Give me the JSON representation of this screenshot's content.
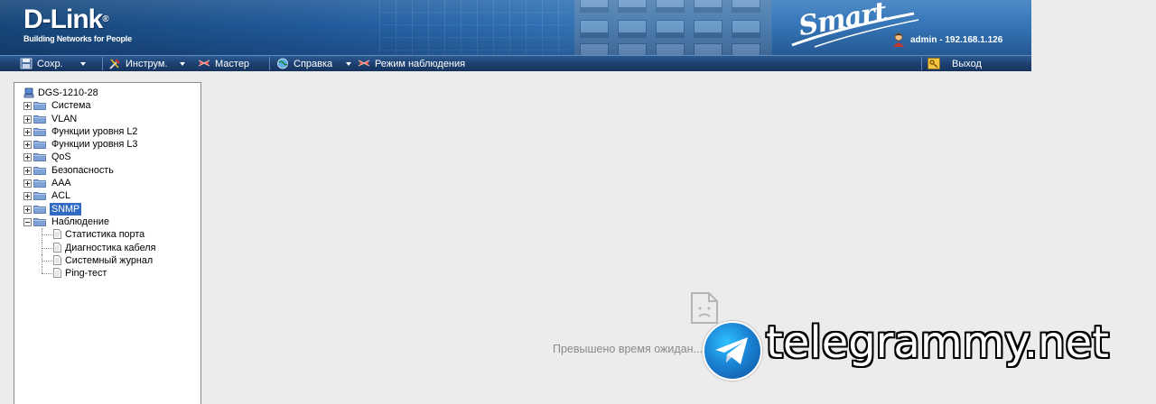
{
  "header": {
    "logo_text": "D-Link",
    "logo_reg": "®",
    "tagline": "Building Networks for People",
    "product_badge": "Smart",
    "user_info": "admin - 192.168.1.126"
  },
  "toolbar": {
    "save": "Сохр.",
    "tools": "Инструм.",
    "wizard": "Мастер",
    "help": "Справка",
    "monitor_mode": "Режим наблюдения",
    "logout": "Выход"
  },
  "tree": {
    "root": "DGS-1210-28",
    "folders": [
      {
        "label": "Система"
      },
      {
        "label": "VLAN"
      },
      {
        "label": "Функции уровня L2"
      },
      {
        "label": "Функции уровня L3"
      },
      {
        "label": "QoS"
      },
      {
        "label": "Безопасность"
      },
      {
        "label": "AAA"
      },
      {
        "label": "ACL"
      },
      {
        "label": "SNMP"
      },
      {
        "label": "Наблюдение"
      }
    ],
    "monitor_children": [
      {
        "label": "Статистика порта"
      },
      {
        "label": "Диагностика кабеля"
      },
      {
        "label": "Системный журнал"
      },
      {
        "label": "Ping-тест"
      }
    ]
  },
  "content": {
    "error_message": "Превышено время ожидан... от ... я"
  },
  "watermark": {
    "text": "telegrammy.net"
  },
  "colors": {
    "banner_dark": "#17477a",
    "toolbar": "#1c3f6f",
    "selection": "#316ac5",
    "content_bg": "#ececec"
  }
}
